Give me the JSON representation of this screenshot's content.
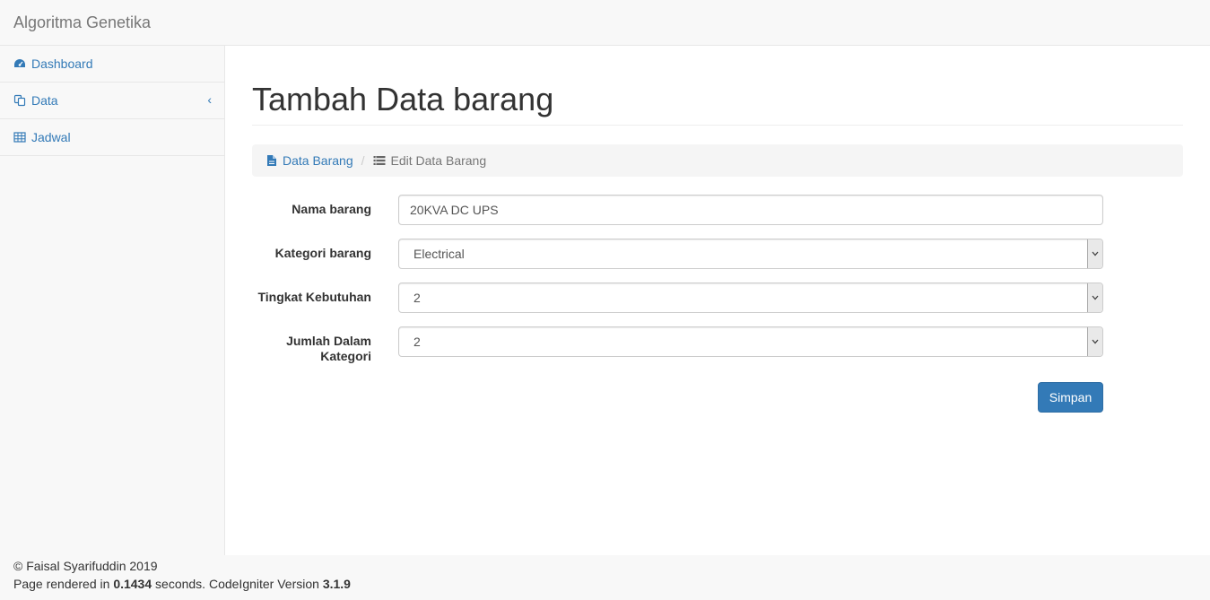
{
  "app": {
    "brand": "Algoritma Genetika"
  },
  "sidebar": {
    "items": [
      {
        "label": "Dashboard",
        "icon": "dashboard-icon"
      },
      {
        "label": "Data",
        "icon": "copy-icon",
        "arrow": "‹"
      },
      {
        "label": "Jadwal",
        "icon": "table-icon"
      }
    ]
  },
  "page": {
    "title": "Tambah Data barang"
  },
  "breadcrumb": {
    "link_label": "Data Barang",
    "link_icon": "file-icon",
    "separator": "/",
    "active_label": "Edit Data Barang",
    "active_icon": "list-icon"
  },
  "form": {
    "nama": {
      "label": "Nama barang",
      "value": "20KVA DC UPS"
    },
    "kategori": {
      "label": "Kategori barang",
      "value": "Electrical"
    },
    "tingkat": {
      "label": "Tingkat Kebutuhan",
      "value": "2"
    },
    "jumlah": {
      "label": "Jumlah Dalam Kategori",
      "value": "2"
    },
    "submit_label": "Simpan"
  },
  "footer": {
    "copyright": "© Faisal Syarifuddin 2019",
    "render_prefix": "Page rendered in ",
    "render_time": "0.1434",
    "render_mid": " seconds. CodeIgniter Version ",
    "version": "3.1.9"
  },
  "colors": {
    "primary": "#337ab7",
    "link": "#337ab7",
    "navbar_bg": "#f8f8f8"
  }
}
